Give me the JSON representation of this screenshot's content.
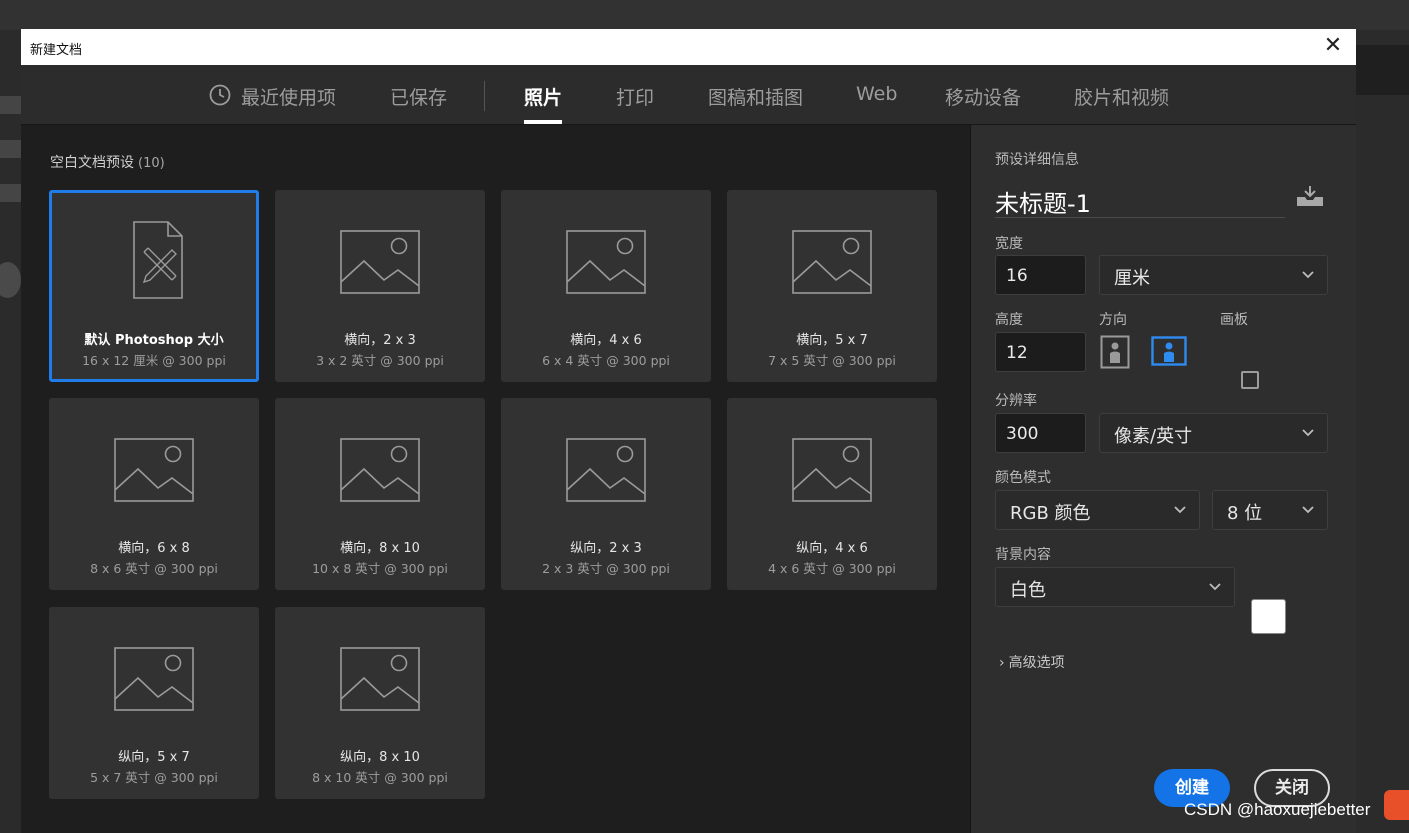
{
  "window": {
    "title": "新建文档",
    "close_glyph": "✕"
  },
  "tabs": [
    {
      "label": "最近使用项",
      "icon": "clock-icon"
    },
    {
      "label": "已保存"
    },
    {
      "label": "照片",
      "active": true
    },
    {
      "label": "打印"
    },
    {
      "label": "图稿和插图"
    },
    {
      "label": "Web"
    },
    {
      "label": "移动设备"
    },
    {
      "label": "胶片和视频"
    }
  ],
  "presets": {
    "heading": "空白文档预设",
    "count": "(10)",
    "items": [
      {
        "name": "默认 Photoshop 大小",
        "desc": "16 x 12 厘米 @ 300 ppi",
        "icon": "document-icon",
        "selected": true
      },
      {
        "name": "横向，2 x 3",
        "desc": "3 x 2 英寸 @ 300 ppi",
        "icon": "image-icon"
      },
      {
        "name": "横向，4 x 6",
        "desc": "6 x 4 英寸 @ 300 ppi",
        "icon": "image-icon"
      },
      {
        "name": "横向，5 x 7",
        "desc": "7 x 5 英寸 @ 300 ppi",
        "icon": "image-icon"
      },
      {
        "name": "横向，6 x 8",
        "desc": "8 x 6 英寸 @ 300 ppi",
        "icon": "image-icon"
      },
      {
        "name": "横向，8 x 10",
        "desc": "10 x 8 英寸 @ 300 ppi",
        "icon": "image-icon"
      },
      {
        "name": "纵向，2 x 3",
        "desc": "2 x 3 英寸 @ 300 ppi",
        "icon": "image-icon"
      },
      {
        "name": "纵向，4 x 6",
        "desc": "4 x 6 英寸 @ 300 ppi",
        "icon": "image-icon"
      },
      {
        "name": "纵向，5 x 7",
        "desc": "5 x 7 英寸 @ 300 ppi",
        "icon": "image-icon"
      },
      {
        "name": "纵向，8 x 10",
        "desc": "8 x 10 英寸 @ 300 ppi",
        "icon": "image-icon"
      }
    ]
  },
  "details": {
    "heading": "预设详细信息",
    "doc_name": "未标题-1",
    "width_label": "宽度",
    "width_value": "16",
    "width_unit": "厘米",
    "height_label": "高度",
    "height_value": "12",
    "orientation_label": "方向",
    "artboard_label": "画板",
    "resolution_label": "分辨率",
    "resolution_value": "300",
    "resolution_unit": "像素/英寸",
    "color_mode_label": "颜色模式",
    "color_mode": "RGB 颜色",
    "bit_depth": "8 位",
    "background_label": "背景内容",
    "background": "白色",
    "background_swatch": "#ffffff",
    "advanced": "高级选项"
  },
  "buttons": {
    "create": "创建",
    "close": "关闭"
  },
  "watermark": "CSDN @haoxuejiebetter",
  "colors": {
    "accent": "#1473e6",
    "selection": "#1f7ce8",
    "dialog_bg": "#1e1e1e",
    "panel_bg": "#2e2e2e"
  }
}
